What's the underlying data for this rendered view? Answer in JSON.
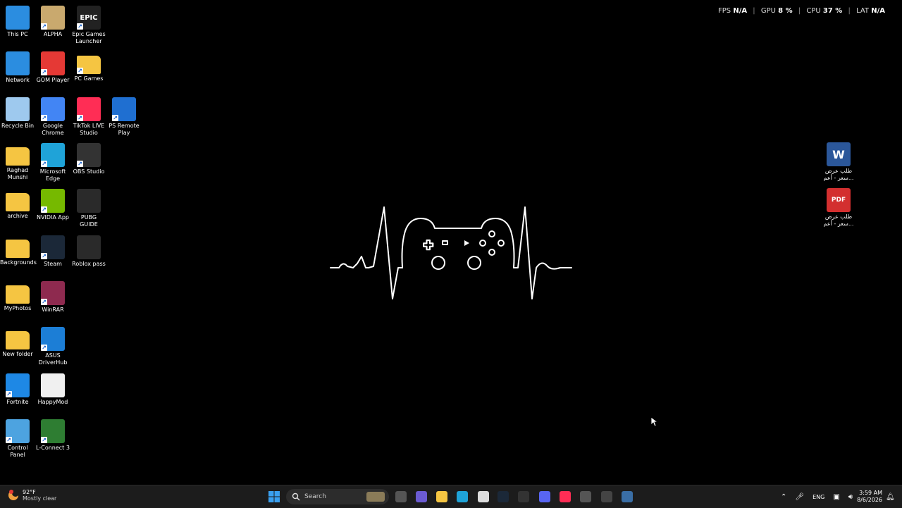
{
  "overlay": {
    "fps_label": "FPS",
    "fps_value": "N/A",
    "gpu_label": "GPU",
    "gpu_value": "8 %",
    "cpu_label": "CPU",
    "cpu_value": "37 %",
    "lat_label": "LAT",
    "lat_value": "N/A",
    "separator": "|"
  },
  "desktop_icons": [
    {
      "label": "This PC",
      "icon": "monitor-icon",
      "color": "#2b8de0"
    },
    {
      "label": "ALPHA",
      "icon": "app-icon",
      "color": "#c9a96e"
    },
    {
      "label": "Epic Games Launcher",
      "icon": "epic-icon",
      "color": "#222222"
    },
    {
      "label": "Network",
      "icon": "network-icon",
      "color": "#2b8de0"
    },
    {
      "label": "GOM Player",
      "icon": "gom-icon",
      "color": "#e53935"
    },
    {
      "label": "PC Games",
      "icon": "folder-icon",
      "color": "#f5c542"
    },
    {
      "label": "Recycle Bin",
      "icon": "recycle-bin-icon",
      "color": "#9ec9ee"
    },
    {
      "label": "Google Chrome",
      "icon": "chrome-icon",
      "color": "#4285f4"
    },
    {
      "label": "TikTok LIVE Studio",
      "icon": "tiktok-icon",
      "color": "#ff2d55"
    },
    {
      "label": "PS Remote Play",
      "icon": "ps-icon",
      "color": "#1f6fd1"
    },
    {
      "label": "Raghad Munshi",
      "icon": "folder-icon",
      "color": "#f5c542"
    },
    {
      "label": "Microsoft Edge",
      "icon": "edge-icon",
      "color": "#1fa3d8"
    },
    {
      "label": "OBS Studio",
      "icon": "obs-icon",
      "color": "#333333"
    },
    {
      "label": "archive",
      "icon": "archive-icon",
      "color": "#f5c542"
    },
    {
      "label": "NVIDIA App",
      "icon": "nvidia-icon",
      "color": "#76b900"
    },
    {
      "label": "PUBG GUIDE",
      "icon": "image-icon",
      "color": "#2a2a2a"
    },
    {
      "label": "Backgrounds",
      "icon": "folder-icon",
      "color": "#f5c542"
    },
    {
      "label": "Steam",
      "icon": "steam-icon",
      "color": "#1b2838"
    },
    {
      "label": "Roblox pass",
      "icon": "image-icon",
      "color": "#2a2a2a"
    },
    {
      "label": "MyPhotos",
      "icon": "folder-icon",
      "color": "#f5c542"
    },
    {
      "label": "WinRAR",
      "icon": "winrar-icon",
      "color": "#8e2a4f"
    },
    {
      "label": "New folder",
      "icon": "folder-icon",
      "color": "#f5c542"
    },
    {
      "label": "ASUS DriverHub",
      "icon": "gear-icon",
      "color": "#1c7ed6"
    },
    {
      "label": "Fortnite",
      "icon": "fortnite-icon",
      "color": "#1e88e5"
    },
    {
      "label": "HappyMod",
      "icon": "file-icon",
      "color": "#f0f0f0"
    },
    {
      "label": "Control Panel",
      "icon": "control-panel-icon",
      "color": "#4da3e0"
    },
    {
      "label": "L-Connect 3",
      "icon": "shield-icon",
      "color": "#2e7d32"
    },
    {
      "label": "طلب عرض سعر - أعم...",
      "icon": "word-icon",
      "color": "#2b579a",
      "glyph": "W"
    },
    {
      "label": "طلب عرض سعر - أعم...",
      "icon": "pdf-icon",
      "color": "#d32f2f",
      "glyph": "PDF"
    }
  ],
  "icon_glyphs": {
    "epic": "EPIC",
    "word": "W",
    "pdf": "PDF"
  },
  "taskbar": {
    "search_placeholder": "Search",
    "weather_temp": "92°F",
    "weather_desc": "Mostly clear",
    "language": "ENG",
    "time": "3:59 AM",
    "date": "8/6/2026",
    "items": [
      {
        "name": "start-button",
        "icon": "windows-icon"
      },
      {
        "name": "task-view-button",
        "icon": "task-view-icon"
      },
      {
        "name": "copilot-button",
        "icon": "copilot-icon"
      },
      {
        "name": "file-explorer-button",
        "icon": "folder-icon"
      },
      {
        "name": "edge-taskbar-button",
        "icon": "edge-icon"
      },
      {
        "name": "store-button",
        "icon": "store-icon"
      },
      {
        "name": "steam-taskbar-button",
        "icon": "steam-icon"
      },
      {
        "name": "game-taskbar-button",
        "icon": "game-icon"
      },
      {
        "name": "discord-taskbar-button",
        "icon": "discord-icon"
      },
      {
        "name": "tiktok-taskbar-button",
        "icon": "tiktok-icon"
      },
      {
        "name": "obs-taskbar-button",
        "icon": "obs-icon"
      },
      {
        "name": "epic-taskbar-button",
        "icon": "epic-icon"
      },
      {
        "name": "app-taskbar-button",
        "icon": "app-icon"
      }
    ]
  }
}
